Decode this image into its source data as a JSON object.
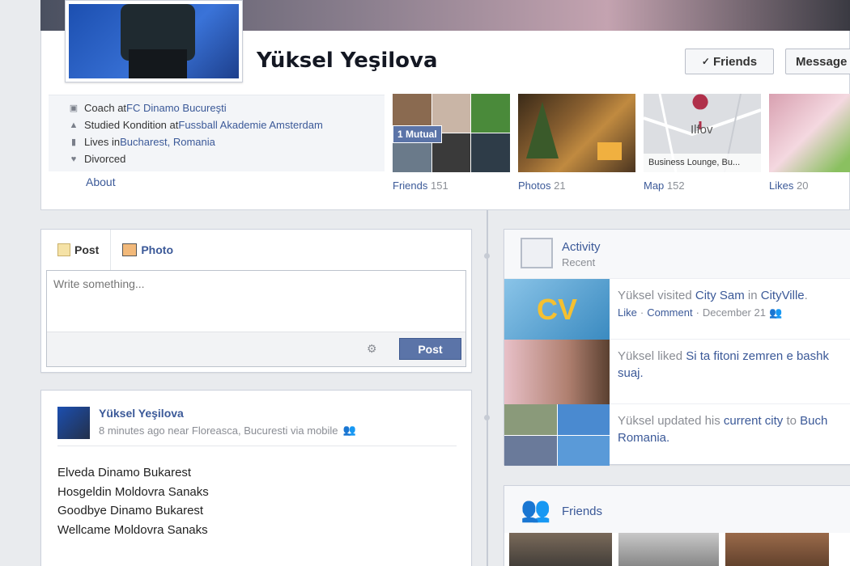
{
  "profile": {
    "name": "Yüksel Yeşilova",
    "friends_button": "Friends",
    "message_button": "Message",
    "info": {
      "work_prefix": "Coach at ",
      "work_link": "FC Dinamo Bucureşti",
      "edu_prefix": "Studied Kondition at ",
      "edu_link": "Fussball Akademie Amsterdam",
      "lives_prefix": "Lives in ",
      "lives_link": "Bucharest, Romania",
      "relationship": "Divorced"
    },
    "about_link": "About"
  },
  "tiles": [
    {
      "label": "Friends",
      "count": "151",
      "badge": "1 Mutual"
    },
    {
      "label": "Photos",
      "count": "21"
    },
    {
      "label": "Map",
      "count": "152",
      "map_text": "Ilfov",
      "map_caption": "Business Lounge, Bu..."
    },
    {
      "label": "Likes",
      "count": "20"
    }
  ],
  "composer": {
    "tab_post": "Post",
    "tab_photo": "Photo",
    "placeholder": "Write something...",
    "post_button": "Post"
  },
  "story": {
    "author": "Yüksel Yeşilova",
    "meta": "8 minutes ago near Floreasca, Bucuresti via mobile",
    "lines": [
      "Elveda Dinamo Bukarest",
      "Hosgeldin Moldovra Sanaks",
      "Goodbye Dinamo Bukarest",
      "Wellcame Moldovra Sanaks"
    ]
  },
  "activity": {
    "title": "Activity",
    "subtitle": "Recent",
    "items": [
      {
        "pre": "Yüksel visited ",
        "link1": "City Sam",
        "mid": " in ",
        "link2": "CityVille",
        "post": ".",
        "like": "Like",
        "comment": "Comment",
        "date": "December 21"
      },
      {
        "pre": "Yüksel liked ",
        "link1": "Si ta fitoni zemren e bashk",
        "line2": "suaj."
      },
      {
        "pre": "Yüksel updated his ",
        "link1": "current city",
        "mid": " to ",
        "link2": "Buch",
        "line2": "Romania."
      }
    ]
  },
  "friends_box": {
    "title": "Friends"
  },
  "colors": {
    "brand": "#3b5998",
    "post_button": "#5b74a8",
    "background": "#e9ebee"
  }
}
